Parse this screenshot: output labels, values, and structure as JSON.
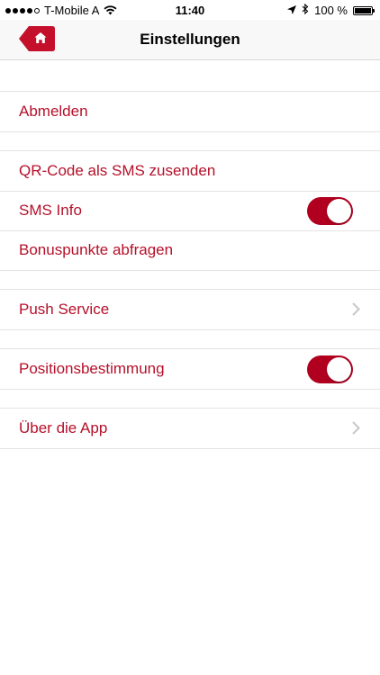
{
  "status_bar": {
    "carrier": "T-Mobile A",
    "time": "11:40",
    "battery": "100 %",
    "battery_level": 1.0,
    "signal_bars": 4,
    "signal_max": 5
  },
  "nav": {
    "title": "Einstellungen"
  },
  "settings": {
    "logout": "Abmelden",
    "qr_sms": "QR-Code als SMS zusenden",
    "sms_info": "SMS Info",
    "sms_info_on": true,
    "bonus_points": "Bonuspunkte abfragen",
    "push_service": "Push Service",
    "location": "Positionsbestimmung",
    "location_on": true,
    "about": "Über die App"
  },
  "colors": {
    "accent": "#b5102a",
    "toggle_on": "#b1001f",
    "home_button": "#c4102b"
  }
}
